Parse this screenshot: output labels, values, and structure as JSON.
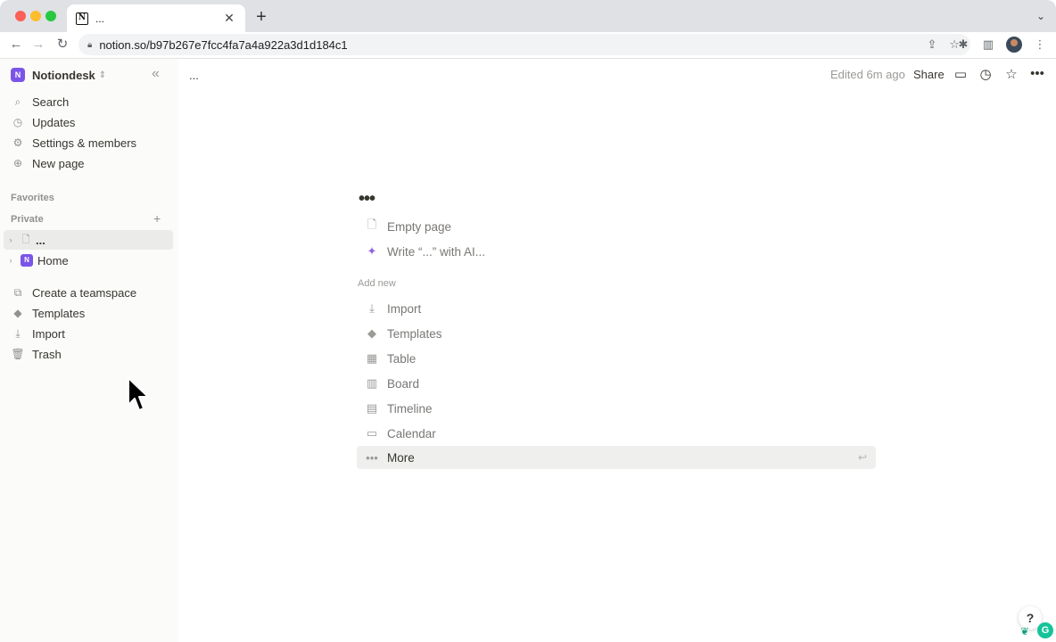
{
  "browser": {
    "tab_title": "...",
    "tab_favicon": "N",
    "close_glyph": "✕",
    "new_tab_glyph": "+",
    "tab_menu_glyph": "⌄",
    "url": "notion.so/b97b267e7fcc4fa7a4a922a3d1d184c1",
    "icons": [
      "back-icon",
      "forward-icon",
      "reload-icon",
      "lock-icon",
      "share-page-icon",
      "bookmark-star-icon",
      "extensions-icon",
      "side-panel-icon",
      "profile-avatar",
      "kebab-menu-icon"
    ]
  },
  "sidebar": {
    "workspace_name": "Notiondesk",
    "workspace_logo": "N",
    "top_items": [
      {
        "label": "Search",
        "icon": "search-icon"
      },
      {
        "label": "Updates",
        "icon": "clock-icon"
      },
      {
        "label": "Settings & members",
        "icon": "gear-icon"
      },
      {
        "label": "New page",
        "icon": "plus-circle-icon"
      }
    ],
    "favorites_label": "Favorites",
    "private_label": "Private",
    "pages": [
      {
        "label": "...",
        "icon": "page-icon",
        "active": true
      },
      {
        "label": "Home",
        "icon": "notion-logo-icon",
        "active": false
      }
    ],
    "bottom_items": [
      {
        "label": "Create a teamspace",
        "icon": "teamspace-icon"
      },
      {
        "label": "Templates",
        "icon": "shapes-icon"
      },
      {
        "label": "Import",
        "icon": "download-icon"
      },
      {
        "label": "Trash",
        "icon": "trash-icon"
      }
    ]
  },
  "topbar": {
    "breadcrumb": "...",
    "edited": "Edited 6m ago",
    "share_label": "Share"
  },
  "main": {
    "page_title": "•••",
    "quick_options": [
      {
        "label": "Empty page",
        "icon": "page-icon"
      },
      {
        "label": "Write “...” with AI...",
        "icon": "sparkle-icon"
      }
    ],
    "add_new_label": "Add new",
    "add_new_items": [
      {
        "label": "Import",
        "icon": "download-icon"
      },
      {
        "label": "Templates",
        "icon": "shapes-icon"
      },
      {
        "label": "Table",
        "icon": "table-icon"
      },
      {
        "label": "Board",
        "icon": "board-icon"
      },
      {
        "label": "Timeline",
        "icon": "timeline-icon"
      },
      {
        "label": "Calendar",
        "icon": "calendar-icon"
      },
      {
        "label": "More",
        "icon": "more-dots-icon",
        "highlighted": true
      }
    ]
  },
  "help_label": "?",
  "grammarly_label": "G"
}
